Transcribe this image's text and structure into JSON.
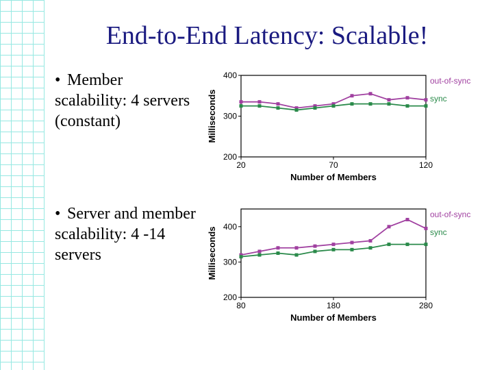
{
  "title": "End-to-End Latency: Scalable!",
  "bullets": [
    "Member scalability: 4 servers (constant)",
    "Server and member scalability: 4 -14 servers"
  ],
  "chart_data": [
    {
      "type": "line",
      "title": "",
      "xlabel": "Number of Members",
      "ylabel": "Milliseconds",
      "xlim": [
        20,
        120
      ],
      "ylim": [
        200,
        400
      ],
      "xticks": [
        20,
        70,
        120
      ],
      "yticks": [
        200,
        300,
        400
      ],
      "legend_position": "right",
      "series": [
        {
          "name": "out-of-sync",
          "color": "#a040a0",
          "x": [
            20,
            30,
            40,
            50,
            60,
            70,
            80,
            90,
            100,
            110,
            120
          ],
          "y": [
            335,
            335,
            330,
            320,
            325,
            330,
            350,
            355,
            340,
            345,
            340
          ]
        },
        {
          "name": "sync",
          "color": "#2a8a4a",
          "x": [
            20,
            30,
            40,
            50,
            60,
            70,
            80,
            90,
            100,
            110,
            120
          ],
          "y": [
            325,
            325,
            320,
            315,
            320,
            325,
            330,
            330,
            330,
            325,
            325
          ]
        }
      ]
    },
    {
      "type": "line",
      "title": "",
      "xlabel": "Number of Members",
      "ylabel": "Milliseconds",
      "xlim": [
        80,
        280
      ],
      "ylim": [
        200,
        450
      ],
      "xticks": [
        80,
        180,
        280
      ],
      "yticks": [
        200,
        300,
        400
      ],
      "legend_position": "right",
      "series": [
        {
          "name": "out-of-sync",
          "color": "#a040a0",
          "x": [
            80,
            100,
            120,
            140,
            160,
            180,
            200,
            220,
            240,
            260,
            280
          ],
          "y": [
            320,
            330,
            340,
            340,
            345,
            350,
            355,
            360,
            400,
            420,
            395
          ]
        },
        {
          "name": "sync",
          "color": "#2a8a4a",
          "x": [
            80,
            100,
            120,
            140,
            160,
            180,
            200,
            220,
            240,
            260,
            280
          ],
          "y": [
            315,
            320,
            325,
            320,
            330,
            335,
            335,
            340,
            350,
            350,
            350
          ]
        }
      ]
    }
  ]
}
